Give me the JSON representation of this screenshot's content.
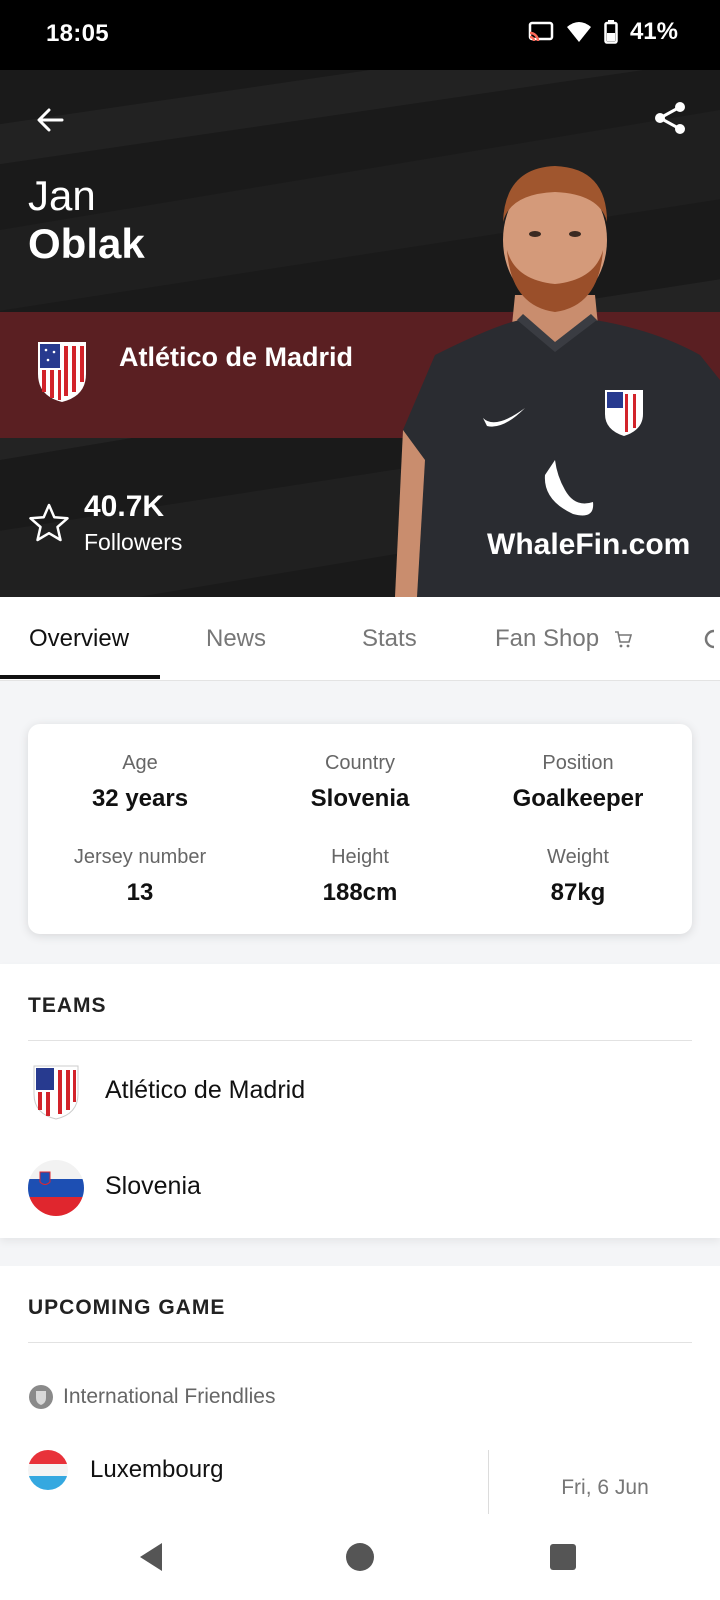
{
  "status_bar": {
    "time": "18:05",
    "battery": "41%"
  },
  "player": {
    "first_name": "Jan",
    "last_name": "Oblak",
    "club": "Atlético de Madrid",
    "followers_count": "40.7K",
    "followers_label": "Followers",
    "sponsor_text": "WhaleFin.com"
  },
  "tabs": [
    {
      "label": "Overview",
      "active": true
    },
    {
      "label": "News"
    },
    {
      "label": "Stats"
    },
    {
      "label": "Fan Shop"
    }
  ],
  "info": [
    {
      "label": "Age",
      "value": "32 years"
    },
    {
      "label": "Country",
      "value": "Slovenia"
    },
    {
      "label": "Position",
      "value": "Goalkeeper"
    },
    {
      "label": "Jersey number",
      "value": "13"
    },
    {
      "label": "Height",
      "value": "188cm"
    },
    {
      "label": "Weight",
      "value": "87kg"
    }
  ],
  "teams": {
    "title": "TEAMS",
    "items": [
      {
        "name": "Atlético de Madrid"
      },
      {
        "name": "Slovenia"
      }
    ]
  },
  "upcoming": {
    "title": "UPCOMING GAME",
    "competition": "International Friendlies",
    "team": "Luxembourg",
    "date": "Fri, 6 Jun"
  },
  "colors": {
    "accent_band": "#5a1f22",
    "hero_bg": "#1a1a1a"
  }
}
